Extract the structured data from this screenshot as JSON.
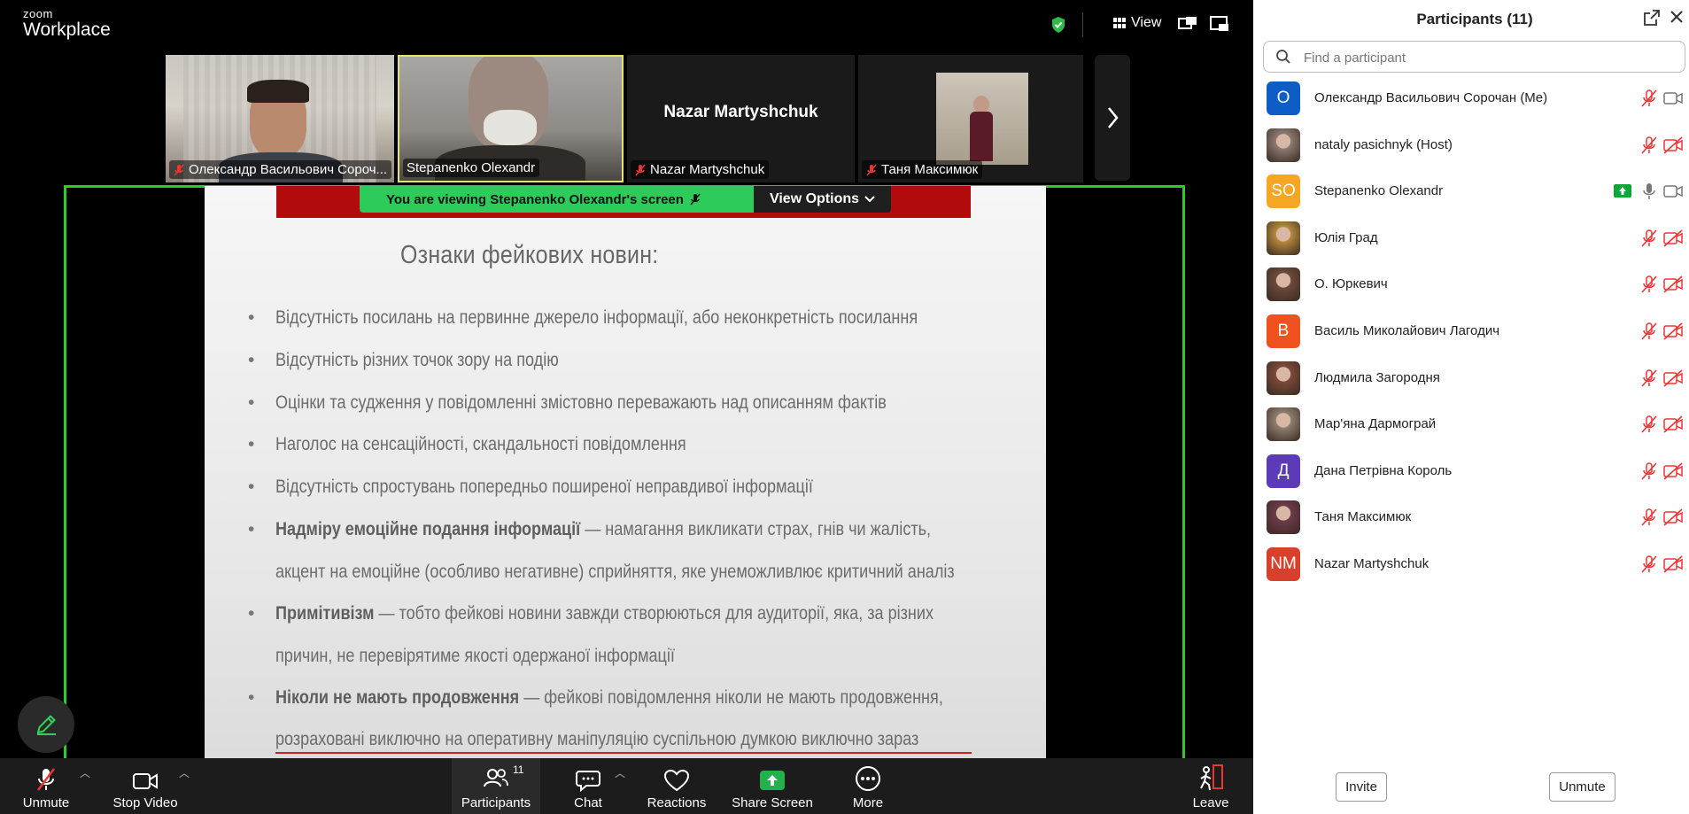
{
  "app": {
    "logo_small": "zoom",
    "logo_big": "Workplace"
  },
  "topbar": {
    "view_label": "View"
  },
  "thumbnails": [
    {
      "name": "Олександр Васильович Сороч...",
      "muted": true
    },
    {
      "name": "Stepanenko Olexandr",
      "muted": false,
      "active": true
    },
    {
      "name": "Nazar Martyshchuk",
      "muted": true,
      "big_name": "Nazar Martyshchuk"
    },
    {
      "name": "Таня Максимюк",
      "muted": true
    }
  ],
  "share": {
    "viewing_text": "You are viewing  Stepanenko Olexandr's screen",
    "view_options": "View Options"
  },
  "slide": {
    "title": "Ознаки фейкових новин:",
    "bullets": [
      {
        "lines": [
          "Відсутність посилань на  первинне джерело інформації, або  неконкретність посилання"
        ]
      },
      {
        "lines": [
          "Відсутність різних точок зору на подію"
        ]
      },
      {
        "lines": [
          "Оцінки  та судження  у повідомленні  змістовно переважають над описанням фактів"
        ]
      },
      {
        "lines": [
          "Наголос на сенсаційності, скандальності повідомлення"
        ]
      },
      {
        "lines": [
          "Відсутність спростувань попередньо поширеної неправдивої інформації"
        ]
      },
      {
        "bold": "Надміру емоційне подання інформації",
        "lines": [
          " — намагання викликати страх, гнів чи жалість,",
          "акцент на емоційне (особливо негативне) сприйняття, яке унеможливлює критичний аналіз"
        ]
      },
      {
        "bold": "Примітивізм",
        "lines": [
          " — тобто фейкові новини завжди створюються для аудиторії, яка, за різних",
          "причин, не перевірятиме якості одержаної інформації"
        ]
      },
      {
        "bold": "Ніколи не мають продовження",
        "lines": [
          " — фейкові повідомлення ніколи не мають продовження,",
          "розраховані виключно на оперативну маніпуляцію суспільною думкою виключно зараз"
        ]
      }
    ]
  },
  "toolbar": {
    "unmute": "Unmute",
    "stop_video": "Stop Video",
    "participants": "Participants",
    "participants_count": "11",
    "chat": "Chat",
    "reactions": "Reactions",
    "share_screen": "Share Screen",
    "more": "More",
    "leave": "Leave"
  },
  "panel": {
    "title": "Participants (11)",
    "search_placeholder": "Find a participant",
    "invite": "Invite",
    "unmute": "Unmute",
    "participants": [
      {
        "name": "Олександр Васильович Сорочан (Me)",
        "initials": "О",
        "color": "#0e5cc5",
        "photo": false,
        "mic": "muted",
        "cam": "on"
      },
      {
        "name": "nataly pasichnyk (Host)",
        "initials": "",
        "color": "#8a7a70",
        "photo": true,
        "mic": "muted",
        "cam": "off"
      },
      {
        "name": "Stepanenko Olexandr",
        "initials": "SO",
        "color": "#f5a623",
        "photo": false,
        "mic": "on",
        "cam": "on",
        "sharing": true
      },
      {
        "name": "Юлія Град",
        "initials": "",
        "color": "#b5893e",
        "photo": true,
        "mic": "muted",
        "cam": "off"
      },
      {
        "name": "О. Юркевич",
        "initials": "",
        "color": "#6b4a3a",
        "photo": true,
        "mic": "muted",
        "cam": "off"
      },
      {
        "name": "Василь Миколайович Лагодич",
        "initials": "В",
        "color": "#f0521f",
        "photo": false,
        "mic": "muted",
        "cam": "off"
      },
      {
        "name": "Людмила Загородня",
        "initials": "",
        "color": "#7a4a3a",
        "photo": true,
        "mic": "muted",
        "cam": "off"
      },
      {
        "name": "Мар'яна Дармограй",
        "initials": "",
        "color": "#8d8070",
        "photo": true,
        "mic": "muted",
        "cam": "off"
      },
      {
        "name": "Дана Петрівна Король",
        "initials": "Д",
        "color": "#5b3bb8",
        "photo": false,
        "mic": "muted",
        "cam": "off"
      },
      {
        "name": "Таня Максимюк",
        "initials": "",
        "color": "#6d3a4a",
        "photo": true,
        "mic": "muted",
        "cam": "off"
      },
      {
        "name": "Nazar Martyshchuk",
        "initials": "NM",
        "color": "#d8402b",
        "photo": false,
        "mic": "muted",
        "cam": "off"
      }
    ]
  }
}
